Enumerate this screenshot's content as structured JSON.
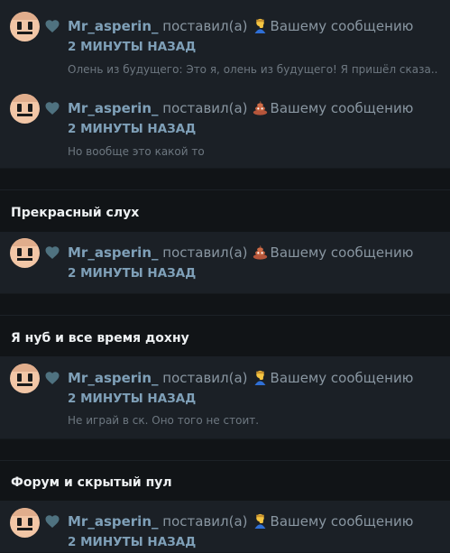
{
  "colors": {
    "page_bg": "#111417",
    "card_bg": "#1b2026",
    "username": "#7fa0b8",
    "text_muted": "#8996a1",
    "excerpt": "#6d7780"
  },
  "groups": [
    {
      "topic": "",
      "notifications": [
        {
          "user": "Mr_asperin_",
          "action": "поставил(а)",
          "reaction_icon": "man-facepalming-icon",
          "target": "Вашему сообщению",
          "time": "2 МИНУТЫ НАЗАД",
          "excerpt": "Олень из будущего: Это я, олень из будущего! Я пришёл сказа..."
        },
        {
          "user": "Mr_asperin_",
          "action": "поставил(а)",
          "reaction_icon": "pile-of-poo-icon",
          "target": "Вашему сообщению",
          "time": "2 МИНУТЫ НАЗАД",
          "excerpt": "Но вообще это какой то"
        }
      ]
    },
    {
      "topic": "Прекрасный слух",
      "notifications": [
        {
          "user": "Mr_asperin_",
          "action": "поставил(а)",
          "reaction_icon": "pile-of-poo-icon",
          "target": "Вашему сообщению",
          "time": "2 МИНУТЫ НАЗАД",
          "excerpt": ""
        }
      ]
    },
    {
      "topic": "Я нуб и все время дохну",
      "notifications": [
        {
          "user": "Mr_asperin_",
          "action": "поставил(а)",
          "reaction_icon": "man-facepalming-icon",
          "target": "Вашему сообщению",
          "time": "2 МИНУТЫ НАЗАД",
          "excerpt": "Не играй в ск. Оно того не стоит."
        }
      ]
    },
    {
      "topic": "Форум и скрытый пул",
      "notifications": [
        {
          "user": "Mr_asperin_",
          "action": "поставил(а)",
          "reaction_icon": "man-facepalming-icon",
          "target": "Вашему сообщению",
          "time": "2 МИНУТЫ НАЗАД",
          "excerpt": ""
        }
      ]
    }
  ]
}
